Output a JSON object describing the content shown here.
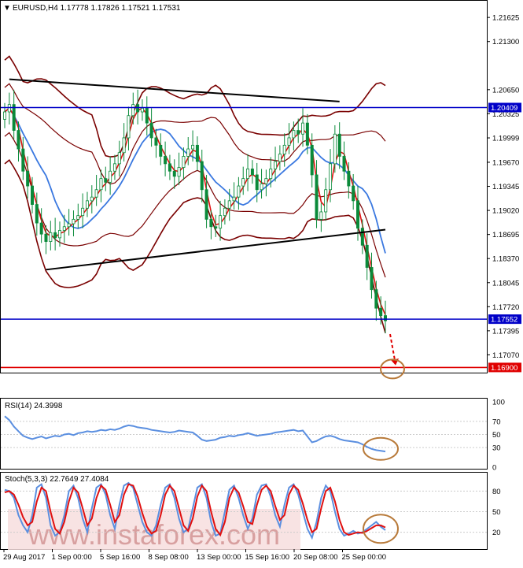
{
  "header": {
    "symbol_line": "EURUSD,H4  1.17778 1.17826 1.17521 1.17531",
    "rsi_line": "RSI(14) 24.3998",
    "stoch_line": "Stoch(5,3,3) 22.7649 27.4084"
  },
  "watermark": "www.instaforex.com",
  "colors": {
    "candle": "#0a8a3a",
    "bollinger": "#7a0000",
    "ma_fast": "#e01010",
    "ma_slow": "#3a78e0",
    "trendline": "#000000",
    "support_resistance": "#0000c8",
    "target": "#e00000",
    "osc_main": "#5b8fe0",
    "osc_signal": "#e01010",
    "circle": "#b87a3a"
  },
  "chart_data": [
    {
      "type": "candlestick",
      "title": "EURUSD,H4",
      "ohlc_current": {
        "open": 1.17778,
        "high": 1.17826,
        "low": 1.17521,
        "close": 1.17531
      },
      "y_ticks": [
        1.21625,
        1.213,
        1.2065,
        1.20325,
        1.19999,
        1.1967,
        1.19345,
        1.1902,
        1.18695,
        1.1837,
        1.18045,
        1.1772,
        1.17395,
        1.1707
      ],
      "y_tick_labels": [
        "1.21625",
        "1.21300",
        "1.20650",
        "1.20325",
        "1.19999",
        "1.19670",
        "1.19345",
        "1.19020",
        "1.18695",
        "1.18370",
        "1.18045",
        "1.17720",
        "1.17395",
        "1.17070"
      ],
      "ylim": [
        1.1683,
        1.2185
      ],
      "x_tick_labels": [
        "29 Aug 2017",
        "1 Sep 00:00",
        "5 Sep 16:00",
        "8 Sep 08:00",
        "13 Sep 00:00",
        "15 Sep 16:00",
        "20 Sep 08:00",
        "25 Sep 00:00"
      ],
      "levels": [
        {
          "value": 1.20409,
          "label": "1.20409",
          "kind": "resistance"
        },
        {
          "value": 1.17552,
          "label": "1.17552",
          "kind": "support"
        },
        {
          "value": 1.169,
          "label": "1.16900",
          "kind": "target"
        }
      ],
      "trendlines": [
        {
          "from": [
            1,
            1.2079
          ],
          "to": [
            73,
            1.2049
          ]
        },
        {
          "from": [
            9,
            1.1822
          ],
          "to": [
            83,
            1.1876
          ]
        }
      ],
      "close_series": [
        1.2035,
        1.2045,
        1.201,
        1.1985,
        1.1955,
        1.1935,
        1.191,
        1.1885,
        1.187,
        1.186,
        1.1872,
        1.1865,
        1.1875,
        1.188,
        1.1884,
        1.189,
        1.1895,
        1.1905,
        1.1915,
        1.192,
        1.193,
        1.1945,
        1.194,
        1.1955,
        1.1965,
        1.198,
        1.2,
        1.203,
        1.2045,
        1.2035,
        1.204,
        1.202,
        1.2,
        1.199,
        1.1975,
        1.1965,
        1.1955,
        1.1948,
        1.196,
        1.1975,
        1.1985,
        1.199,
        1.1968,
        1.193,
        1.189,
        1.188,
        1.1878,
        1.1895,
        1.1905,
        1.1915,
        1.192,
        1.1935,
        1.1945,
        1.1958,
        1.195,
        1.193,
        1.1938,
        1.1945,
        1.1958,
        1.1968,
        1.1978,
        1.199,
        1.2,
        1.201,
        1.2005,
        1.202,
        1.199,
        1.195,
        1.189,
        1.19,
        1.193,
        1.1965,
        1.2005,
        1.1975,
        1.1955,
        1.1935,
        1.1915,
        1.1878,
        1.1855,
        1.1825,
        1.1795,
        1.177,
        1.176,
        1.1753
      ]
    },
    {
      "type": "line",
      "title": "RSI(14)",
      "current": 24.3998,
      "ylim": [
        0,
        100
      ],
      "y_ticks": [
        0,
        30,
        50,
        70,
        100
      ],
      "y_tick_labels": [
        "0",
        "30",
        "50",
        "70",
        "100"
      ],
      "series": [
        {
          "values": [
            78,
            72,
            62,
            55,
            48,
            45,
            43,
            45,
            47,
            44,
            46,
            48,
            47,
            50,
            51,
            49,
            52,
            53,
            55,
            54,
            55,
            57,
            56,
            58,
            57,
            59,
            62,
            64,
            63,
            61,
            60,
            59,
            57,
            56,
            55,
            54,
            53,
            54,
            56,
            55,
            54,
            53,
            48,
            42,
            40,
            41,
            42,
            45,
            46,
            48,
            47,
            49,
            50,
            52,
            50,
            48,
            49,
            50,
            51,
            53,
            54,
            55,
            56,
            57,
            55,
            56,
            47,
            38,
            40,
            44,
            47,
            48,
            46,
            43,
            41,
            40,
            39,
            38,
            35,
            31,
            28,
            26,
            25,
            24
          ]
        }
      ]
    },
    {
      "type": "line",
      "title": "Stoch(5,3,3)",
      "main": 22.7649,
      "signal": 27.4084,
      "ylim": [
        0,
        100
      ],
      "y_ticks": [
        20,
        50,
        80
      ],
      "y_tick_labels": [
        "20",
        "50",
        "80"
      ],
      "series": [
        {
          "values": [
            82,
            80,
            70,
            45,
            30,
            20,
            45,
            85,
            90,
            70,
            30,
            15,
            20,
            45,
            80,
            88,
            70,
            40,
            20,
            55,
            85,
            90,
            75,
            45,
            25,
            60,
            88,
            92,
            85,
            60,
            35,
            20,
            15,
            30,
            60,
            85,
            90,
            70,
            40,
            20,
            25,
            55,
            85,
            90,
            70,
            35,
            15,
            18,
            50,
            82,
            88,
            70,
            45,
            25,
            40,
            75,
            88,
            90,
            72,
            45,
            28,
            60,
            85,
            90,
            75,
            50,
            25,
            12,
            35,
            70,
            88,
            80,
            50,
            25,
            15,
            18,
            22,
            18,
            20,
            25,
            30,
            35,
            28,
            23
          ]
        },
        {
          "values": [
            78,
            80,
            75,
            60,
            42,
            30,
            35,
            65,
            85,
            80,
            50,
            25,
            18,
            35,
            65,
            85,
            78,
            55,
            30,
            40,
            70,
            88,
            82,
            60,
            35,
            45,
            75,
            90,
            88,
            72,
            48,
            28,
            18,
            22,
            45,
            75,
            88,
            80,
            55,
            30,
            22,
            40,
            72,
            88,
            80,
            50,
            25,
            16,
            35,
            70,
            85,
            78,
            58,
            35,
            32,
            60,
            82,
            88,
            80,
            58,
            38,
            45,
            75,
            88,
            82,
            62,
            38,
            20,
            25,
            55,
            80,
            85,
            65,
            38,
            20,
            16,
            18,
            20,
            19,
            22,
            26,
            30,
            30,
            27
          ]
        }
      ]
    }
  ]
}
